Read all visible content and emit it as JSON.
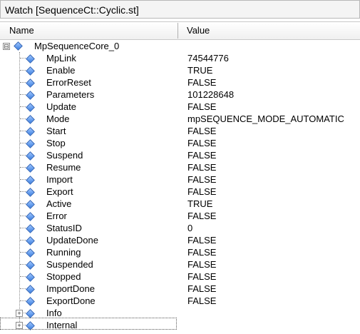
{
  "window": {
    "title": "Watch [SequenceCt::Cyclic.st]"
  },
  "columns": {
    "name": "Name",
    "value": "Value"
  },
  "root": {
    "name": "MpSequenceCore_0",
    "expander": "⊟"
  },
  "items": [
    {
      "name": "MpLink",
      "value": "74544776"
    },
    {
      "name": "Enable",
      "value": "TRUE"
    },
    {
      "name": "ErrorReset",
      "value": "FALSE"
    },
    {
      "name": "Parameters",
      "value": "101228648"
    },
    {
      "name": "Update",
      "value": "FALSE"
    },
    {
      "name": "Mode",
      "value": "mpSEQUENCE_MODE_AUTOMATIC"
    },
    {
      "name": "Start",
      "value": "FALSE"
    },
    {
      "name": "Stop",
      "value": "FALSE"
    },
    {
      "name": "Suspend",
      "value": "FALSE"
    },
    {
      "name": "Resume",
      "value": "FALSE"
    },
    {
      "name": "Import",
      "value": "FALSE"
    },
    {
      "name": "Export",
      "value": "FALSE"
    },
    {
      "name": "Active",
      "value": "TRUE"
    },
    {
      "name": "Error",
      "value": "FALSE"
    },
    {
      "name": "StatusID",
      "value": "0"
    },
    {
      "name": "UpdateDone",
      "value": "FALSE"
    },
    {
      "name": "Running",
      "value": "FALSE"
    },
    {
      "name": "Suspended",
      "value": "FALSE"
    },
    {
      "name": "Stopped",
      "value": "FALSE"
    },
    {
      "name": "ImportDone",
      "value": "FALSE"
    },
    {
      "name": "ExportDone",
      "value": "FALSE"
    }
  ],
  "collapsed": [
    {
      "name": "Info",
      "value": "",
      "expander": "+"
    },
    {
      "name": "Internal",
      "value": "",
      "expander": "+"
    }
  ],
  "colors": {
    "diamond": "#3b7fe0",
    "border": "#b8b8b8"
  }
}
